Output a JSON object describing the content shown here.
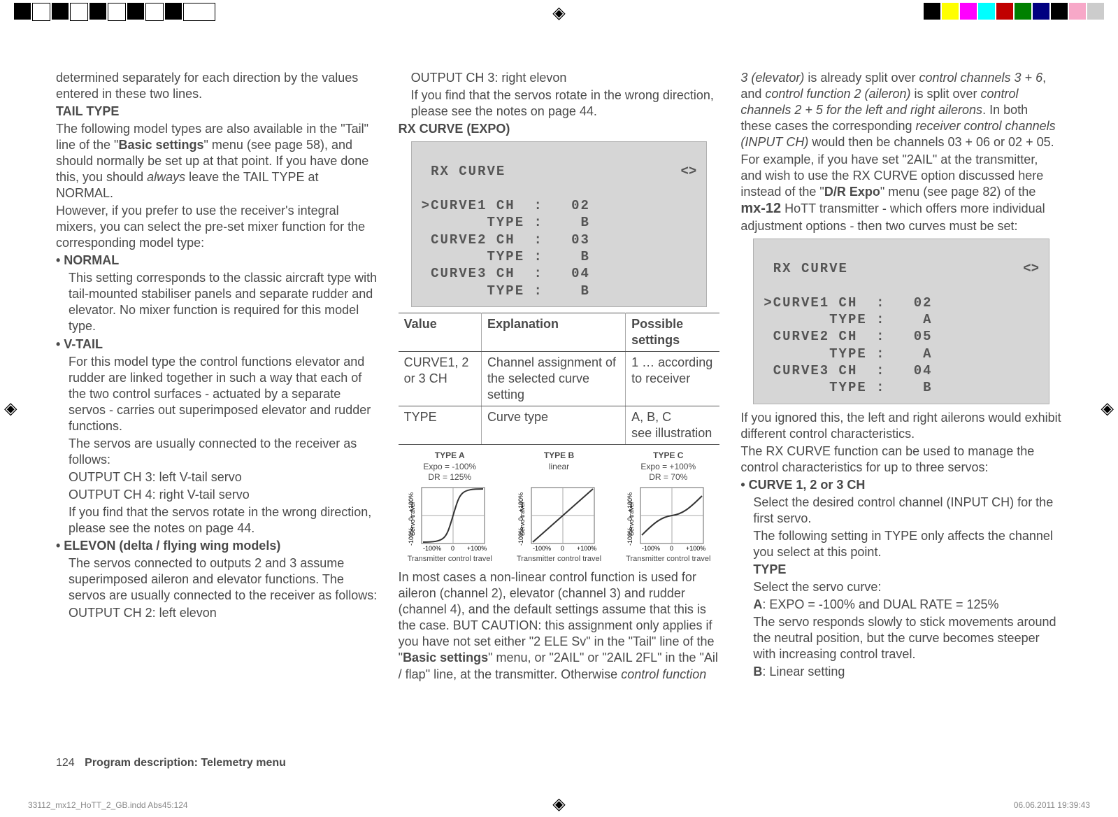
{
  "col1": {
    "intro": "determined separately for each direction by the values entered in these two lines.",
    "tail_heading": "TAIL TYPE",
    "tail_p1a": "The following model types are also available in the \"Tail\" line of the \"",
    "tail_p1_bold": "Basic settings",
    "tail_p1b": "\" menu (see page 58), and should normally be set up at that point. If you have done this, you should ",
    "tail_p1_italic": "always",
    "tail_p1c": " leave the TAIL TYPE at NORMAL.",
    "tail_p2": "However, if you prefer to use the receiver's integral mixers, you can select the pre-set mixer function for the corresponding model type:",
    "normal_b": "• NORMAL",
    "normal_txt": "This setting corresponds to the classic aircraft type with tail-mounted stabiliser panels and separate rudder and elevator. No mixer function is required for this model type.",
    "vtail_b": "• V-TAIL",
    "vtail_txt1": "For this model type the control functions elevator and rudder are linked together in such a way that each of the two control surfaces - actuated by a separate servos - carries out superimposed elevator and rudder functions.",
    "vtail_txt2": "The servos are usually connected to the receiver as follows:",
    "vtail_ch3": "OUTPUT CH 3: left V-tail servo",
    "vtail_ch4": "OUTPUT CH 4: right V-tail servo",
    "vtail_txt3": "If you find that the servos rotate in the wrong direction, please see the notes on page 44.",
    "elevon_b": "• ELEVON (delta / flying wing models)",
    "elevon_txt1": "The servos connected to outputs 2 and 3 assume superimposed aileron and elevator functions. The servos are usually connected to the receiver as follows:",
    "elevon_ch2": "OUTPUT CH 2: left elevon"
  },
  "col2": {
    "top_line1": "OUTPUT CH 3: right elevon",
    "top_line2": "If you find that the servos rotate in the wrong direction, please see the notes on page 44.",
    "rx_heading": "RX CURVE (EXPO)",
    "panel1": {
      "title": " RX CURVE",
      "l1": ">CURVE1 CH  :   02",
      "l2": "       TYPE :    B",
      "l3": " CURVE2 CH  :   03",
      "l4": "       TYPE :    B",
      "l5": " CURVE3 CH  :   04",
      "l6": "       TYPE :    B"
    },
    "th_value": "Value",
    "th_expl": "Explanation",
    "th_poss": "Possible settings",
    "r1_value": "CURVE1, 2 or 3 CH",
    "r1_expl": "Channel assignment of the selected curve setting",
    "r1_poss": "1 … according to receiver",
    "r2_value": "TYPE",
    "r2_expl": "Curve type",
    "r2_poss1": "A, B, C",
    "r2_poss2": "see illustration",
    "chart_a_t1": "TYPE A",
    "chart_a_t2": "Expo = -100%",
    "chart_a_t3": "DR = 125%",
    "chart_b_t1": "TYPE B",
    "chart_b_t2": "linear",
    "chart_c_t1": "TYPE C",
    "chart_c_t2": "Expo = +100%",
    "chart_c_t3": "DR = 70%",
    "chart_xlabel": "Transmitter control travel",
    "chart_ylabel": "Servo travel",
    "para1a": "In most cases a non-linear control function is used for aileron (channel 2), elevator (channel 3) and rudder (channel 4), and the default settings assume that this is the case. BUT CAUTION: this assignment only applies if you have not set either \"2 ELE Sv\" in the \"Tail\" line of the \"",
    "para1_bold": "Basic settings",
    "para1b": "\" menu, or \"2AIL\" or \"2AIL 2FL\" in the \"Ail / flap\" line, at the transmitter. Otherwise ",
    "para1_italic": "control function"
  },
  "chart_data": [
    {
      "type": "line",
      "title": "TYPE A Expo = -100% DR = 125%",
      "xlabel": "Transmitter control travel",
      "ylabel": "Servo travel",
      "xlim": [
        -100,
        100
      ],
      "ylim": [
        -100,
        100
      ],
      "x": [
        -100,
        -60,
        -30,
        -10,
        0,
        10,
        30,
        60,
        100
      ],
      "values": [
        -100,
        -95,
        -80,
        -40,
        0,
        40,
        80,
        95,
        100
      ]
    },
    {
      "type": "line",
      "title": "TYPE B linear",
      "xlabel": "Transmitter control travel",
      "ylabel": "Servo travel",
      "xlim": [
        -100,
        100
      ],
      "ylim": [
        -100,
        100
      ],
      "x": [
        -100,
        0,
        100
      ],
      "values": [
        -100,
        0,
        100
      ]
    },
    {
      "type": "line",
      "title": "TYPE C Expo = +100% DR = 70%",
      "xlabel": "Transmitter control travel",
      "ylabel": "Servo travel",
      "xlim": [
        -100,
        100
      ],
      "ylim": [
        -100,
        100
      ],
      "x": [
        -100,
        -60,
        -30,
        0,
        30,
        60,
        100
      ],
      "values": [
        -70,
        -20,
        -5,
        0,
        5,
        20,
        70
      ]
    }
  ],
  "col3": {
    "p1_i1": "3 (elevator)",
    "p1_a": " is already split over ",
    "p1_i2": "control channels 3 + 6",
    "p1_b": ", and ",
    "p1_i3": "control function 2 (aileron)",
    "p1_c": " is split over ",
    "p1_i4": "control channels 2 + 5 for the left and right ailerons",
    "p1_d": ". In both these cases the corresponding ",
    "p1_i5": "receiver control channels (INPUT CH)",
    "p1_e": " would then be channels 03 + 06 or 02 + 05.",
    "p2_a": "For example, if you have set \"2AIL\" at the transmitter, and wish to use the RX CURVE option discussed here instead of the \"",
    "p2_bold": "D/R Expo",
    "p2_b": "\" menu (see page 82) of the ",
    "p2_mx": "mx-12",
    "p2_c": " HoTT transmitter - which offers more individual adjustment options - then two curves must be set:",
    "panel2": {
      "title": " RX CURVE",
      "l1": ">CURVE1 CH  :   02",
      "l2": "       TYPE :    A",
      "l3": " CURVE2 CH  :   05",
      "l4": "       TYPE :    A",
      "l5": " CURVE3 CH  :   04",
      "l6": "       TYPE :    B"
    },
    "p3": "If you ignored this, the left and right ailerons would exhibit different control characteristics.",
    "p4": "The RX CURVE function can be used to manage the control characteristics for up to three servos:",
    "curve_b": "• CURVE 1, 2 or 3 CH",
    "curve_t1": "Select the desired control channel (INPUT CH) for the first servo.",
    "curve_t2": "The following setting in TYPE only affects the channel you select at this point.",
    "type_h": "TYPE",
    "type_t1": "Select the servo curve:",
    "type_a_b": "A",
    "type_a": ": EXPO = -100% and DUAL RATE = 125%",
    "type_a2": "The servo responds slowly to stick movements around the neutral position, but the curve becomes steeper with increasing control travel.",
    "type_b_b": "B",
    "type_b": ": Linear setting"
  },
  "footer": {
    "page": "124",
    "title": "Program description: Telemetry menu",
    "file": "33112_mx12_HoTT_2_GB.indd   Abs45:124",
    "date": "06.06.2011   19:39:43"
  }
}
